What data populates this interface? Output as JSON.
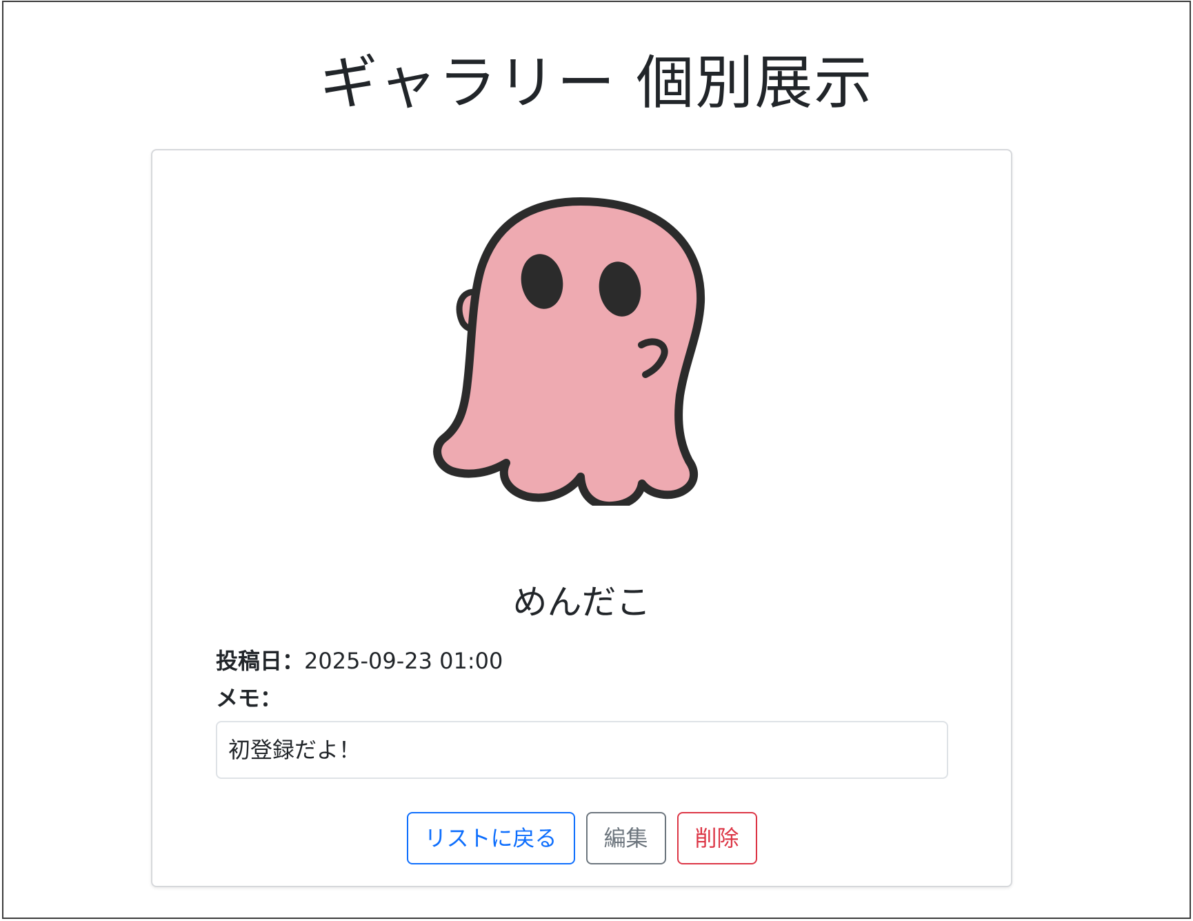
{
  "page": {
    "title": "ギャラリー 個別展示"
  },
  "item": {
    "name": "めんだこ",
    "image_icon": "pink-ghost-octopus-illustration",
    "date_label": "投稿日：",
    "date_value": "2025-09-23 01:00",
    "memo_label": "メモ：",
    "memo_value": "初登録だよ！"
  },
  "actions": {
    "back_label": "リストに戻る",
    "edit_label": "編集",
    "delete_label": "削除"
  },
  "colors": {
    "primary": "#0d6efd",
    "secondary": "#6c757d",
    "danger": "#dc3545",
    "illustration_fill": "#eeaab1",
    "illustration_stroke": "#2b2b2b"
  }
}
